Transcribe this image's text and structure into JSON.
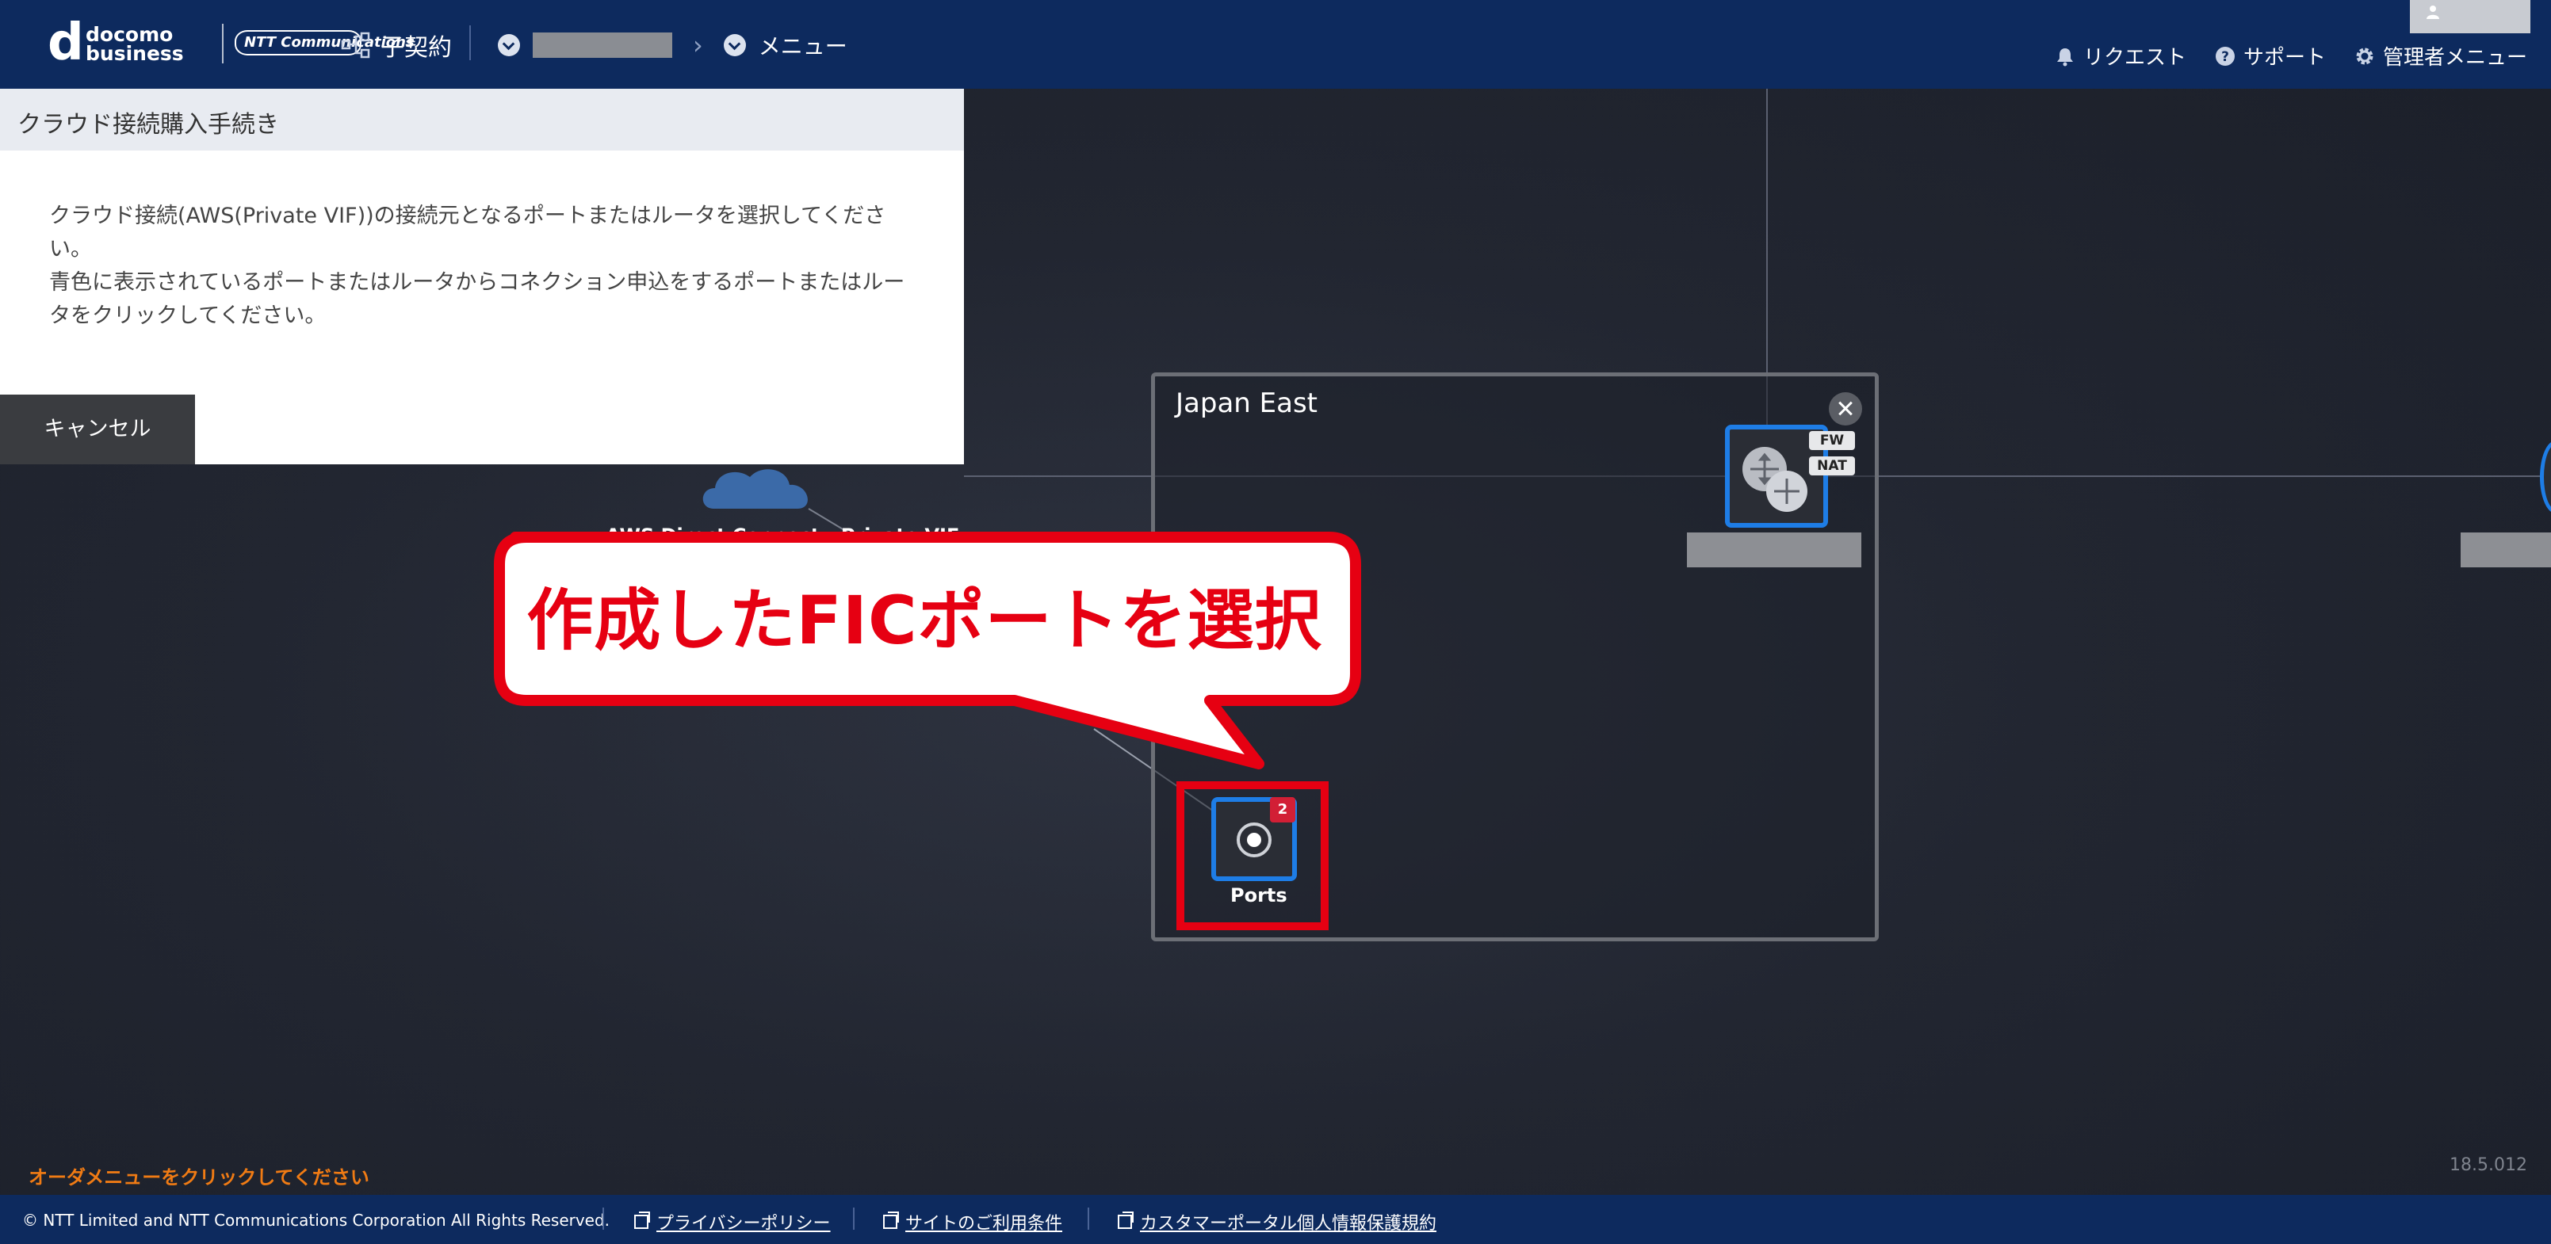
{
  "header": {
    "logo_line1": "docomo",
    "logo_line2": "business",
    "logo_ntt": "NTT Communications",
    "sub_contract": "子契約",
    "breadcrumb_menu": "メニュー",
    "links": [
      {
        "label": "リクエスト",
        "icon": "bell-icon"
      },
      {
        "label": "サポート",
        "icon": "help-icon"
      },
      {
        "label": "管理者メニュー",
        "icon": "gear-icon"
      }
    ]
  },
  "panel": {
    "title": "クラウド接続購入手続き",
    "line1": "クラウド接続(AWS(Private VIF))の接続元となるポートまたはルータを選択してください。",
    "line2": "青色に表示されているポートまたはルータからコネクション申込をするポートまたはルータをクリックしてください。",
    "cancel_label": "キャンセル"
  },
  "canvas": {
    "region_title": "Japan East",
    "router_chips": [
      "FW",
      "NAT"
    ],
    "aws_label": "AWS Direct Connect - Private VIF",
    "ports_label": "Ports",
    "ports_badge": "2",
    "callout": "作成したFICポートを選択"
  },
  "footer": {
    "order_hint": "オーダメニューをクリックしてください",
    "version": "18.5.012",
    "copyright": "© NTT Limited and NTT Communications Corporation All Rights Reserved.",
    "privacy": "プライバシーポリシー",
    "terms": "サイトのご利用条件",
    "customer_portal": "カスタマーポータル個人情報保護規約"
  },
  "colors": {
    "header_bg": "#0d2a5e",
    "node_border": "#1e7de6",
    "highlight": "#e60012",
    "order_hint": "#f07b14"
  }
}
